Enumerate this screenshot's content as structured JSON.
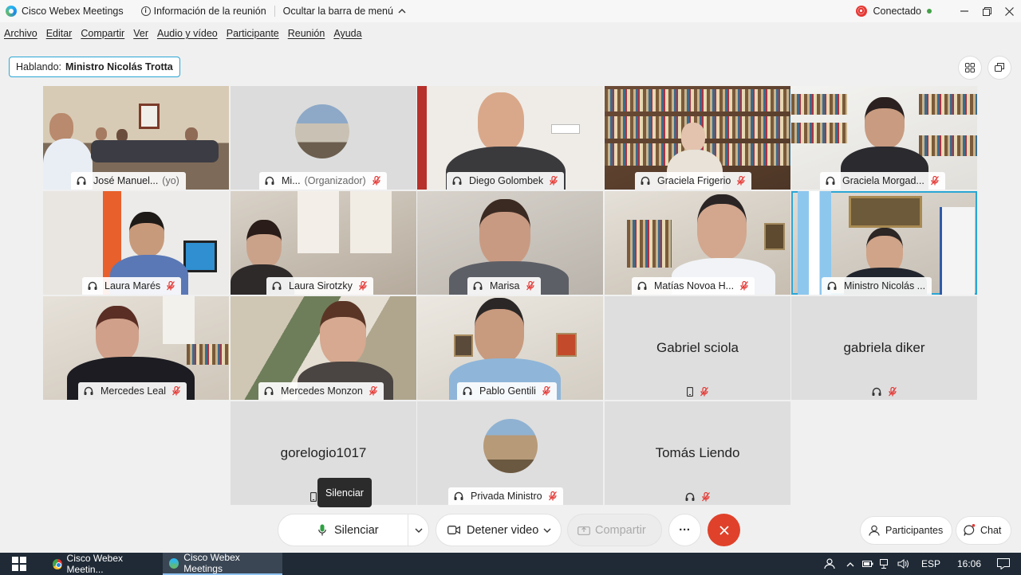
{
  "window": {
    "title": "Cisco Webex Meetings",
    "meeting_info": "Información de la reunión",
    "hide_menu": "Ocultar la barra de menú",
    "status": "Conectado"
  },
  "menu": [
    "Archivo",
    "Editar",
    "Compartir",
    "Ver",
    "Audio y vídeo",
    "Participante",
    "Reunión",
    "Ayuda"
  ],
  "speaking": {
    "label": "Hablando:",
    "name": "Ministro Nicolás Trotta"
  },
  "tiles": {
    "t1": {
      "name": "José Manuel...",
      "suffix": "(yo)"
    },
    "t2": {
      "name": "Mi...",
      "suffix": "(Organizador)"
    },
    "t3": {
      "name": "Diego Golombek"
    },
    "t4": {
      "name": "Graciela Frigerio"
    },
    "t5": {
      "name": "Graciela Morgad..."
    },
    "t6": {
      "name": "Laura Marés"
    },
    "t7": {
      "name": "Laura Sirotzky"
    },
    "t8": {
      "name": "Marisa"
    },
    "t9": {
      "name": "Matías Novoa H..."
    },
    "t10": {
      "name": "Ministro Nicolás ..."
    },
    "t11": {
      "name": "Mercedes Leal"
    },
    "t12": {
      "name": "Mercedes Monzon"
    },
    "t13": {
      "name": "Pablo Gentili"
    },
    "t14": {
      "name": "Gabriel sciola"
    },
    "t15": {
      "name": "gabriela diker"
    },
    "t16": {
      "name": "gorelogio1017"
    },
    "t17": {
      "name": "Privada Ministro"
    },
    "t18": {
      "name": "Tomás Liendo"
    }
  },
  "tooltip": "Silenciar",
  "controls": {
    "mute": "Silenciar",
    "video": "Detener video",
    "share": "Compartir",
    "more": "···",
    "participants": "Participantes",
    "chat": "Chat"
  },
  "taskbar": {
    "app1": "Cisco Webex Meetin...",
    "app2": "Cisco Webex Meetings",
    "lang": "ESP",
    "time": "16:06"
  },
  "colors": {
    "accent": "#2aa6d4",
    "end_call": "#e0412a",
    "mute_icon": "#e53935",
    "connected": "#43a047"
  }
}
